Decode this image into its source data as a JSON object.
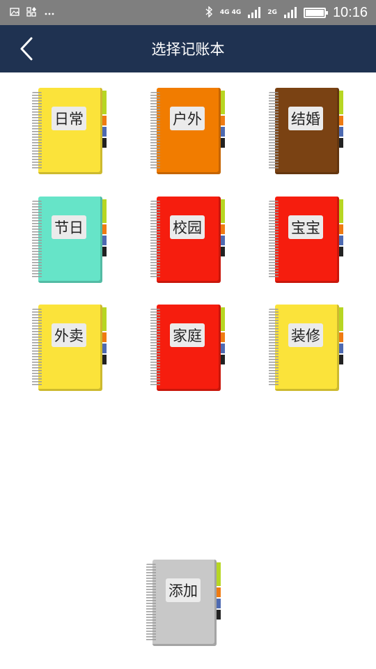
{
  "status_bar": {
    "time": "10:16",
    "network_1": "4G 4G",
    "network_2": "2G",
    "icons": [
      "image-icon",
      "app-icon",
      "more-dots-icon",
      "bluetooth-icon",
      "signal-icon",
      "battery-icon"
    ]
  },
  "header": {
    "title": "选择记账本",
    "back_icon": "chevron-left-icon"
  },
  "notebooks": [
    {
      "label": "日常",
      "color": "#fbe33a"
    },
    {
      "label": "户外",
      "color": "#f17c00"
    },
    {
      "label": "结婚",
      "color": "#7a4213"
    },
    {
      "label": "节日",
      "color": "#66e4c8"
    },
    {
      "label": "校园",
      "color": "#f61d0e"
    },
    {
      "label": "宝宝",
      "color": "#f61d0e"
    },
    {
      "label": "外卖",
      "color": "#fbe33a"
    },
    {
      "label": "家庭",
      "color": "#f61d0e"
    },
    {
      "label": "装修",
      "color": "#fbe33a"
    }
  ],
  "add_notebook": {
    "label": "添加",
    "color": "#c8c8c8"
  }
}
